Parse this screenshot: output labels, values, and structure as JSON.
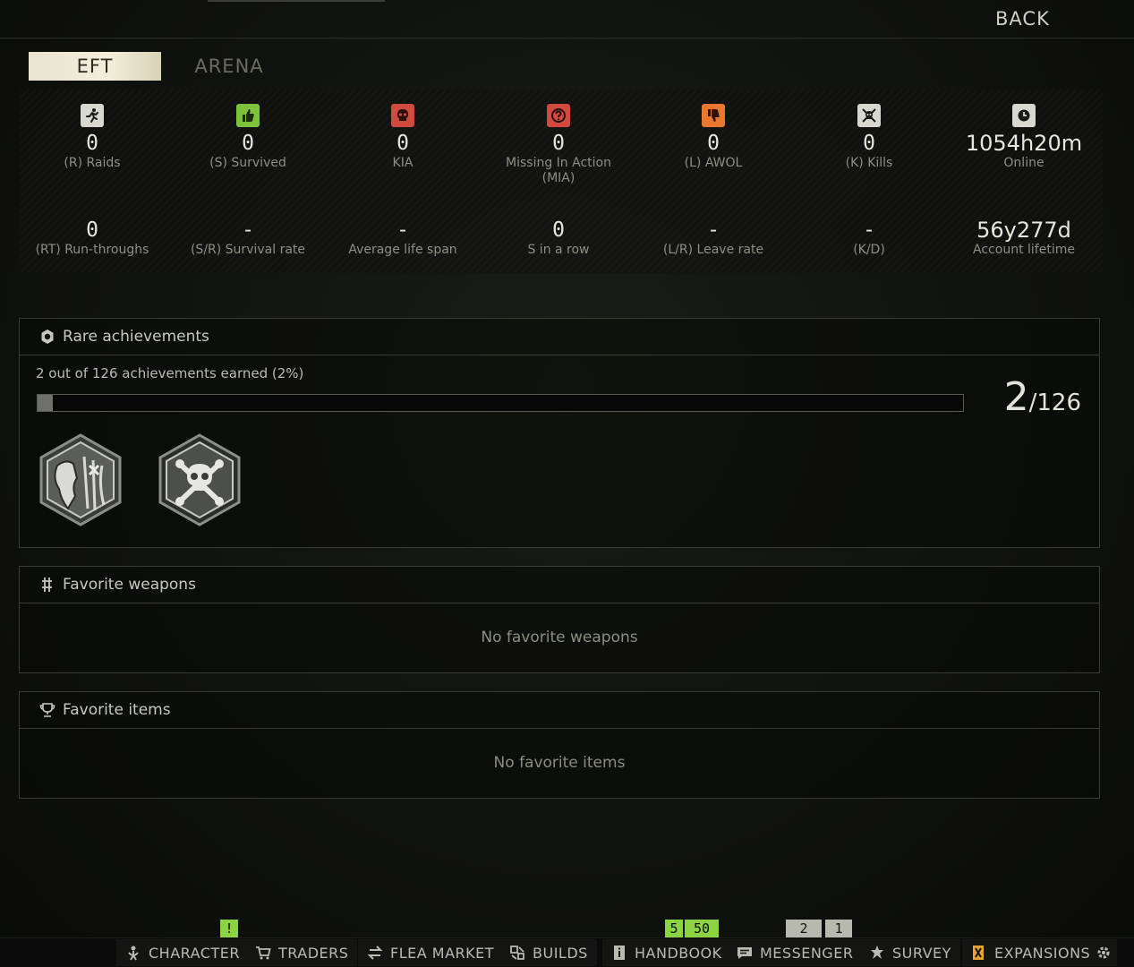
{
  "header": {
    "back_label": "BACK"
  },
  "tabs": [
    {
      "label": "EFT",
      "active": true
    },
    {
      "label": "ARENA",
      "active": false
    }
  ],
  "stats_row1": [
    {
      "icon": "running-man-icon",
      "color": "#d8d8d0",
      "value": "0",
      "label": "(R) Raids"
    },
    {
      "icon": "thumbs-up-icon",
      "color": "#7ec23b",
      "value": "0",
      "label": "(S) Survived"
    },
    {
      "icon": "skull-icon",
      "color": "#d24a3d",
      "value": "0",
      "label": "KIA"
    },
    {
      "icon": "question-icon",
      "color": "#d24a3d",
      "value": "0",
      "label": "Missing In Action",
      "label2": "(MIA)"
    },
    {
      "icon": "thumbs-down-icon",
      "color": "#e8772f",
      "value": "0",
      "label": "(L) AWOL"
    },
    {
      "icon": "skull-crossbones-icon",
      "color": "#d8d8d0",
      "value": "0",
      "label": "(K) Kills"
    },
    {
      "icon": "clock-icon",
      "color": "#d8d8d0",
      "value": "1054h20m",
      "label": "Online"
    }
  ],
  "stats_row2": [
    {
      "value": "0",
      "label": "(RT) Run-throughs"
    },
    {
      "value": "-",
      "label": "(S/R) Survival rate"
    },
    {
      "value": "-",
      "label": "Average life span"
    },
    {
      "value": "0",
      "label": "S in a row"
    },
    {
      "value": "-",
      "label": "(L/R) Leave rate"
    },
    {
      "value": "-",
      "label": "(K/D)"
    },
    {
      "value": "56y277d",
      "label": "Account lifetime"
    }
  ],
  "achievements": {
    "title": "Rare achievements",
    "progress_text": "2 out of 126 achievements earned (2%)",
    "earned": "2",
    "total": "/126",
    "progress_fraction": 0.016,
    "badges": [
      "achievement-beast-badge-icon",
      "achievement-skull-badge-icon"
    ]
  },
  "favorite_weapons": {
    "title": "Favorite weapons",
    "empty": "No favorite weapons"
  },
  "favorite_items": {
    "title": "Favorite items",
    "empty": "No favorite items"
  },
  "notifications": [
    {
      "text": "!",
      "style": "green"
    },
    {
      "text": "5",
      "style": "green"
    },
    {
      "text": "50",
      "style": "green"
    },
    {
      "text": "2",
      "style": "grey"
    },
    {
      "text": "1",
      "style": "grey"
    }
  ],
  "nav": [
    {
      "icon": "character-icon",
      "label": "CHARACTER"
    },
    {
      "icon": "cart-icon",
      "label": "TRADERS"
    },
    {
      "icon": "exchange-icon",
      "label": "FLEA MARKET"
    },
    {
      "icon": "builds-icon",
      "label": "BUILDS"
    },
    {
      "icon": "info-icon",
      "label": "HANDBOOK"
    },
    {
      "icon": "message-icon",
      "label": "MESSENGER"
    },
    {
      "icon": "survey-icon",
      "label": "SURVEY"
    },
    {
      "icon": "expansions-icon",
      "label": "EXPANSIONS"
    },
    {
      "icon": "settings-icon",
      "label": ""
    }
  ]
}
